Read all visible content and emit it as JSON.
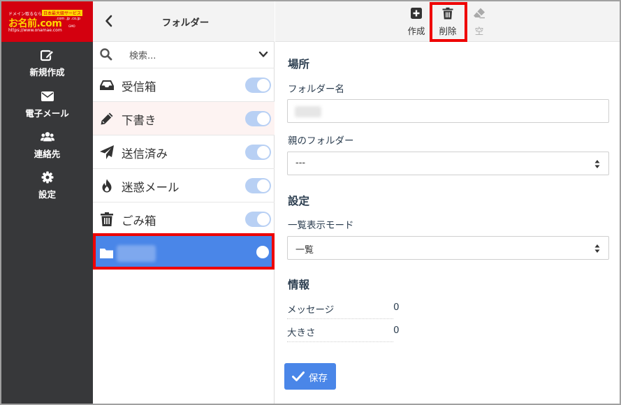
{
  "logo": {
    "line1": "ドメイン取るなら",
    "line1_badge": "日本最大級サービス",
    "brand": "お名前.com",
    "brand_sub": ".com .jp .co.jp",
    "url": "https://www.onamae.com",
    "company": "GMO"
  },
  "nav": {
    "items": [
      {
        "label": "新規作成",
        "icon": "compose-icon"
      },
      {
        "label": "電子メール",
        "icon": "envelope-icon"
      },
      {
        "label": "連絡先",
        "icon": "users-icon"
      },
      {
        "label": "設定",
        "icon": "gear-icon"
      }
    ]
  },
  "list": {
    "title": "フォルダー",
    "search_placeholder": "検索...",
    "folders": [
      {
        "label": "受信箱",
        "icon": "inbox-icon",
        "subscribed": true
      },
      {
        "label": "下書き",
        "icon": "pencil-icon",
        "subscribed": true
      },
      {
        "label": "送信済み",
        "icon": "paper-plane-icon",
        "subscribed": true
      },
      {
        "label": "迷惑メール",
        "icon": "fire-icon",
        "subscribed": true
      },
      {
        "label": "ごみ箱",
        "icon": "trash-icon",
        "subscribed": true
      }
    ]
  },
  "toolbar": {
    "create_label": "作成",
    "delete_label": "削除",
    "empty_label": "空"
  },
  "form": {
    "location_heading": "場所",
    "folder_name_label": "フォルダー名",
    "parent_label": "親のフォルダー",
    "parent_value": "---",
    "settings_heading": "設定",
    "list_mode_label": "一覧表示モード",
    "list_mode_value": "一覧",
    "info_heading": "情報",
    "messages_label": "メッセージ",
    "messages_value": "0",
    "size_label": "大きさ",
    "size_value": "0",
    "save_label": "保存"
  },
  "colors": {
    "nav_bg": "#37383a",
    "logo_red": "#d4000f",
    "accent_blue": "#4a86e8",
    "highlight_red": "#ee0000"
  }
}
